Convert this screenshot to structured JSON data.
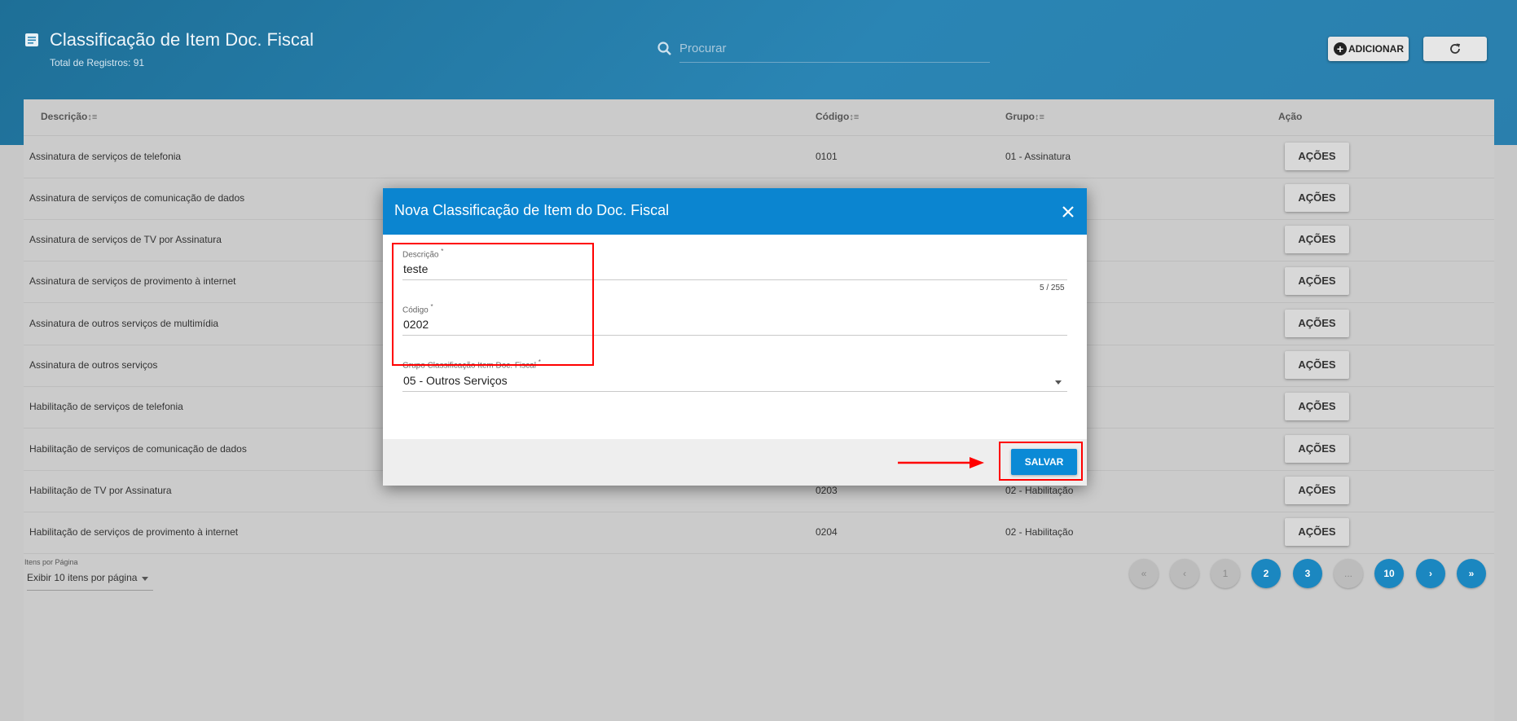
{
  "header": {
    "title": "Classificação de Item Doc. Fiscal",
    "subtitle": "Total de Registros: 91",
    "search_placeholder": "Procurar",
    "add_label": "ADICIONAR"
  },
  "table": {
    "columns": [
      "Descrição",
      "Código",
      "Grupo",
      "Ação"
    ],
    "action_label": "AÇÕES",
    "rows": [
      {
        "descricao": "Assinatura de serviços de telefonia",
        "codigo": "0101",
        "grupo": "01 - Assinatura"
      },
      {
        "descricao": "Assinatura de serviços de comunicação de dados",
        "codigo": "",
        "grupo": ""
      },
      {
        "descricao": "Assinatura de serviços de TV por Assinatura",
        "codigo": "",
        "grupo": ""
      },
      {
        "descricao": "Assinatura de serviços de provimento à internet",
        "codigo": "",
        "grupo": ""
      },
      {
        "descricao": "Assinatura de outros serviços de multimídia",
        "codigo": "",
        "grupo": ""
      },
      {
        "descricao": "Assinatura de outros serviços",
        "codigo": "",
        "grupo": ""
      },
      {
        "descricao": "Habilitação de serviços de telefonia",
        "codigo": "",
        "grupo": ""
      },
      {
        "descricao": "Habilitação de serviços de comunicação de dados",
        "codigo": "",
        "grupo": ""
      },
      {
        "descricao": "Habilitação de TV por Assinatura",
        "codigo": "0203",
        "grupo": "02 - Habilitação"
      },
      {
        "descricao": "Habilitação de serviços de provimento à internet",
        "codigo": "0204",
        "grupo": "02 - Habilitação"
      }
    ]
  },
  "pagination": {
    "items_per_page_label": "Itens por Página",
    "items_per_page_value": "Exibir 10 itens por página",
    "buttons": [
      "«",
      "‹",
      "1",
      "2",
      "3",
      "...",
      "10",
      "›",
      "»"
    ],
    "current_page": "1"
  },
  "modal": {
    "title": "Nova Classificação de Item do Doc. Fiscal",
    "fields": {
      "descricao": {
        "label": "Descrição",
        "value": "teste",
        "counter": "5 / 255"
      },
      "codigo": {
        "label": "Código",
        "value": "0202"
      },
      "grupo": {
        "label": "Grupo Classificação Item Doc. Fiscal",
        "value": "05 - Outros Serviços"
      }
    },
    "required_mark": "*",
    "save_label": "SALVAR"
  },
  "colors": {
    "header": "#2a85b4",
    "modal_header": "#0b85d0",
    "primary_button": "#0b8ad6",
    "page_active": "#1b87c0",
    "highlight": "#ff0000"
  },
  "icons": [
    "list-icon",
    "search-icon",
    "plus-circle-icon",
    "refresh-icon",
    "sort-icon",
    "close-icon",
    "dropdown-caret-icon",
    "arrow-annotation"
  ]
}
